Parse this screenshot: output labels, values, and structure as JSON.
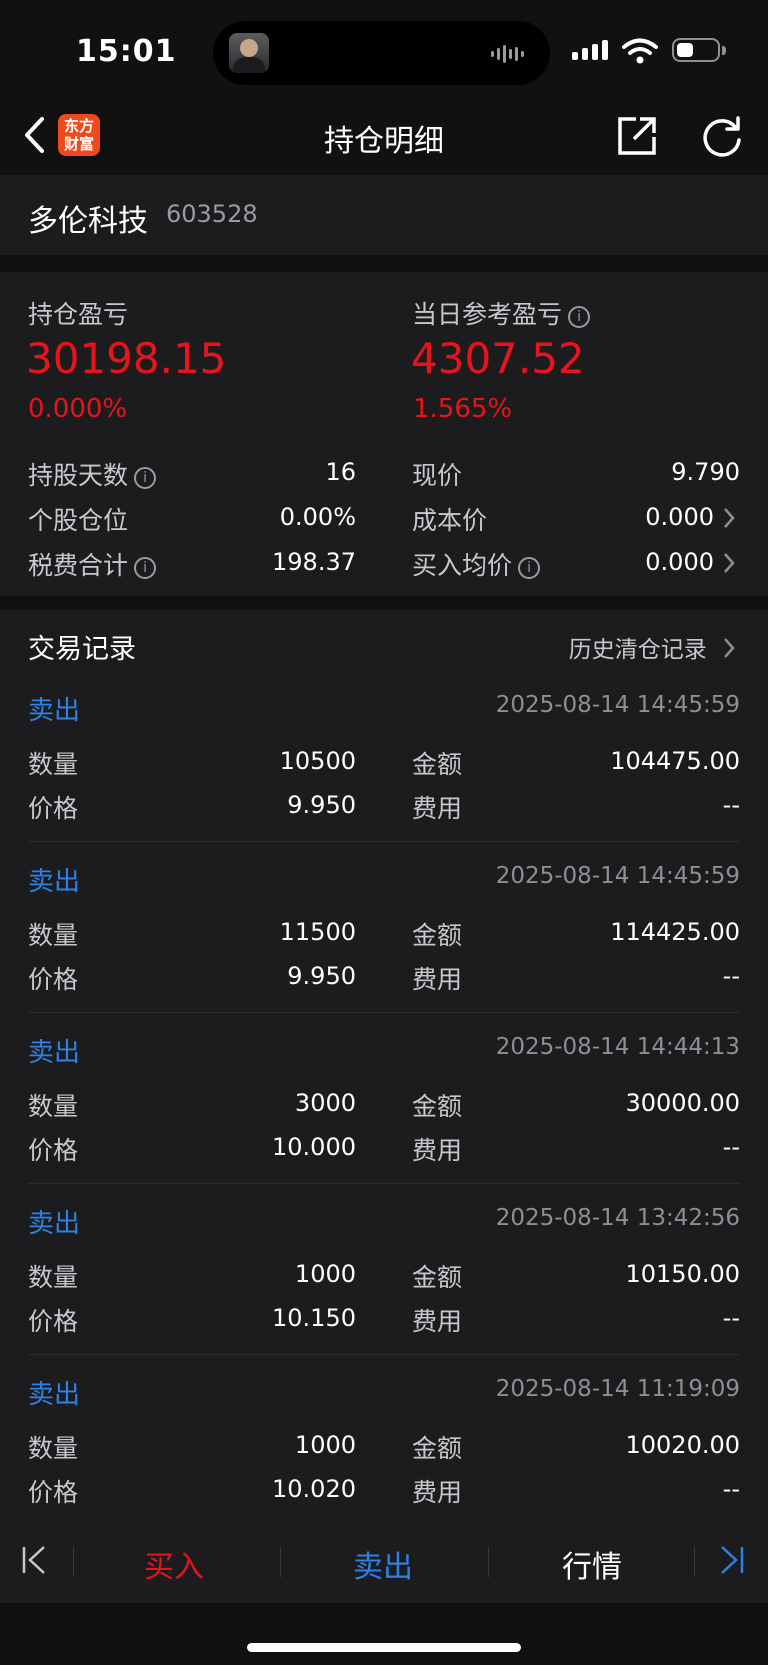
{
  "status": {
    "time": "15:01"
  },
  "nav": {
    "title": "持仓明细",
    "logo_line1": "东方",
    "logo_line2": "财富"
  },
  "stock": {
    "name": "多伦科技",
    "code": "603528"
  },
  "summary": {
    "position_pl_label": "持仓盈亏",
    "position_pl_value": "30198.15",
    "position_pl_pct": "0.000%",
    "day_pl_label": "当日参考盈亏",
    "day_pl_value": "4307.52",
    "day_pl_pct": "1.565%",
    "rows": [
      {
        "left_label": "持股天数",
        "left_value": "16",
        "right_label": "现价",
        "right_value": "9.790"
      },
      {
        "left_label": "个股仓位",
        "left_value": "0.00%",
        "right_label": "成本价",
        "right_value": "0.000"
      },
      {
        "left_label": "税费合计",
        "left_value": "198.37",
        "right_label": "买入均价",
        "right_value": "0.000"
      }
    ],
    "info_glyph": "i",
    "accent_red": "#e8141c"
  },
  "trades": {
    "title": "交易记录",
    "history_link": "历史清仓记录",
    "qty_label": "数量",
    "price_label": "价格",
    "amount_label": "金额",
    "fee_label": "费用",
    "side_color": "#2d82e6",
    "items": [
      {
        "side": "卖出",
        "time": "2025-08-14 14:45:59",
        "qty": "10500",
        "price": "9.950",
        "amount": "104475.00",
        "fee": "--"
      },
      {
        "side": "卖出",
        "time": "2025-08-14 14:45:59",
        "qty": "11500",
        "price": "9.950",
        "amount": "114425.00",
        "fee": "--"
      },
      {
        "side": "卖出",
        "time": "2025-08-14 14:44:13",
        "qty": "3000",
        "price": "10.000",
        "amount": "30000.00",
        "fee": "--"
      },
      {
        "side": "卖出",
        "time": "2025-08-14 13:42:56",
        "qty": "1000",
        "price": "10.150",
        "amount": "10150.00",
        "fee": "--"
      },
      {
        "side": "卖出",
        "time": "2025-08-14 11:19:09",
        "qty": "1000",
        "price": "10.020",
        "amount": "10020.00",
        "fee": "--"
      }
    ]
  },
  "tabbar": {
    "buy": "买入",
    "sell": "卖出",
    "quote": "行情"
  }
}
